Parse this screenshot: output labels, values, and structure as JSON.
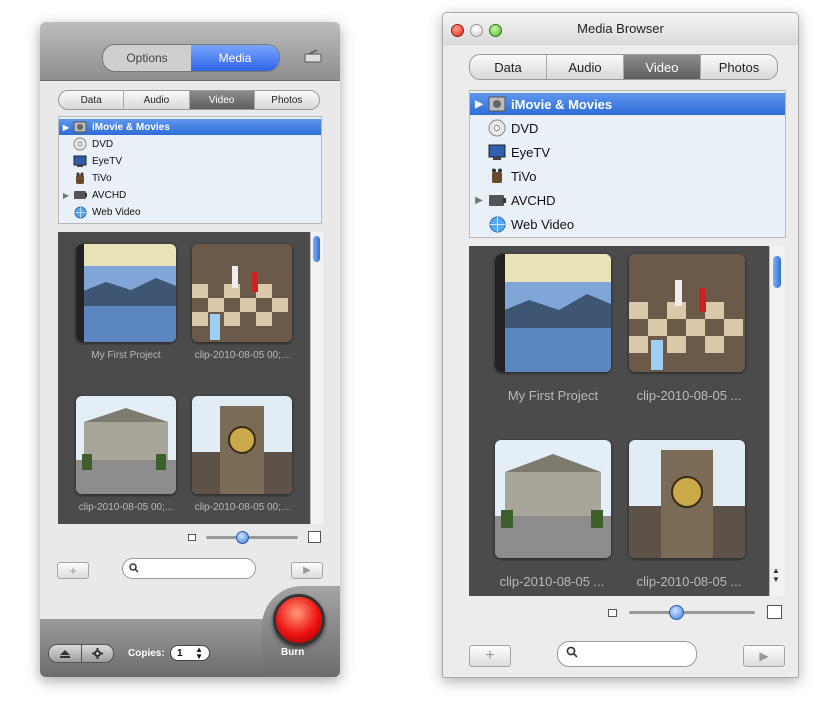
{
  "left": {
    "mode_tabs": [
      "Options",
      "Media"
    ],
    "media_tabs": [
      "Data",
      "Audio",
      "Video",
      "Photos"
    ],
    "sources": [
      "iMovie & Movies",
      "DVD",
      "EyeTV",
      "TiVo",
      "AVCHD",
      "Web Video"
    ],
    "captions": [
      "My First Project",
      "clip-2010-08-05 00;...",
      "clip-2010-08-05 00;...",
      "clip-2010-08-05 00;..."
    ],
    "copies_label": "Copies:",
    "copies_value": "1",
    "burn_label": "Burn"
  },
  "right": {
    "title": "Media Browser",
    "media_tabs": [
      "Data",
      "Audio",
      "Video",
      "Photos"
    ],
    "sources": [
      "iMovie & Movies",
      "DVD",
      "EyeTV",
      "TiVo",
      "AVCHD",
      "Web Video"
    ],
    "captions": [
      "My First Project",
      "clip-2010-08-05 ...",
      "clip-2010-08-05 ...",
      "clip-2010-08-05 ..."
    ]
  },
  "selected_tab": "Video",
  "selected_source": "iMovie & Movies",
  "colors": {
    "accent": "#2f63e6",
    "selection": "#3d7ee0",
    "grid_bg": "#4b4b4b",
    "burn": "#e11111"
  },
  "icons": [
    "eject-icon",
    "gear-icon",
    "search-icon",
    "add-icon",
    "play-icon",
    "film-icon",
    "disc-icon",
    "tv-icon",
    "tivo-icon",
    "camcorder-icon",
    "globe-icon"
  ]
}
